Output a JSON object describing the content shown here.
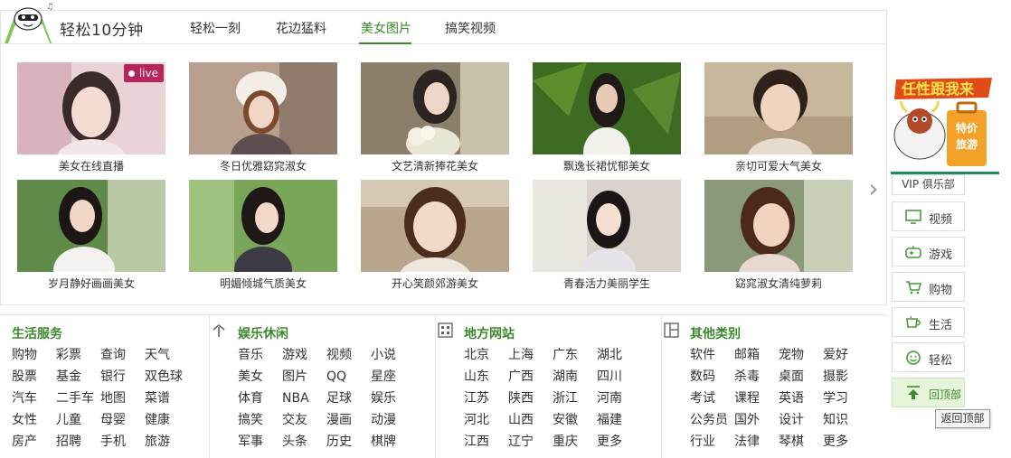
{
  "header": {
    "brand": "轻松10分钟",
    "tabs": [
      {
        "label": "轻松一刻"
      },
      {
        "label": "花边猛料"
      },
      {
        "label": "美女图片",
        "active": true
      },
      {
        "label": "搞笑视频"
      }
    ]
  },
  "photos": [
    {
      "caption": "美女在线直播",
      "badge": "live"
    },
    {
      "caption": "冬日优雅窈窕淑女"
    },
    {
      "caption": "文艺清新捧花美女"
    },
    {
      "caption": "飘逸长裙忧郁美女"
    },
    {
      "caption": "亲切可爱大气美女"
    },
    {
      "caption": "岁月静好画画美女"
    },
    {
      "caption": "明媚倾城气质美女"
    },
    {
      "caption": "开心笑颜郊游美女"
    },
    {
      "caption": "青春活力美丽学生"
    },
    {
      "caption": "窈窕淑女清纯萝莉"
    }
  ],
  "categories": [
    {
      "title": "生活服务",
      "icon": "life-service-icon",
      "links": [
        "购物",
        "彩票",
        "查询",
        "天气",
        "股票",
        "基金",
        "银行",
        "双色球",
        "汽车",
        "二手车",
        "地图",
        "菜谱",
        "女性",
        "儿童",
        "母婴",
        "健康",
        "房产",
        "招聘",
        "手机",
        "旅游"
      ]
    },
    {
      "title": "娱乐休闲",
      "icon": "entertainment-icon",
      "links": [
        "音乐",
        "游戏",
        "视频",
        "小说",
        "美女",
        "图片",
        "QQ",
        "星座",
        "体育",
        "NBA",
        "足球",
        "娱乐",
        "搞笑",
        "交友",
        "漫画",
        "动漫",
        "军事",
        "头条",
        "历史",
        "棋牌"
      ]
    },
    {
      "title": "地方网站",
      "icon": "local-sites-icon",
      "links": [
        "北京",
        "上海",
        "广东",
        "湖北",
        "山东",
        "广西",
        "湖南",
        "四川",
        "江苏",
        "陕西",
        "浙江",
        "河南",
        "河北",
        "山西",
        "安徽",
        "福建",
        "江西",
        "辽宁",
        "重庆",
        "更多"
      ]
    },
    {
      "title": "其他类别",
      "icon": "other-categories-icon",
      "links": [
        "软件",
        "邮箱",
        "宠物",
        "爱好",
        "数码",
        "杀毒",
        "桌面",
        "摄影",
        "考试",
        "课程",
        "英语",
        "学习",
        "公务员",
        "国外",
        "设计",
        "知识",
        "行业",
        "法律",
        "琴棋",
        "更多"
      ]
    }
  ],
  "rail": {
    "promo_line1": "任性跟我来",
    "promo_line2": "特价",
    "promo_line3": "旅游",
    "vip": "VIP 俱乐部",
    "items": [
      {
        "label": "视频",
        "icon": "monitor-icon"
      },
      {
        "label": "游戏",
        "icon": "gamepad-icon"
      },
      {
        "label": "购物",
        "icon": "cart-icon"
      },
      {
        "label": "生活",
        "icon": "cup-icon"
      },
      {
        "label": "轻松",
        "icon": "smile-icon"
      },
      {
        "label": "回顶部",
        "icon": "up-arrow-icon"
      }
    ],
    "tooltip": "返回顶部"
  },
  "colors": {
    "accent": "#3a8a2c",
    "live": "#b7245c"
  }
}
